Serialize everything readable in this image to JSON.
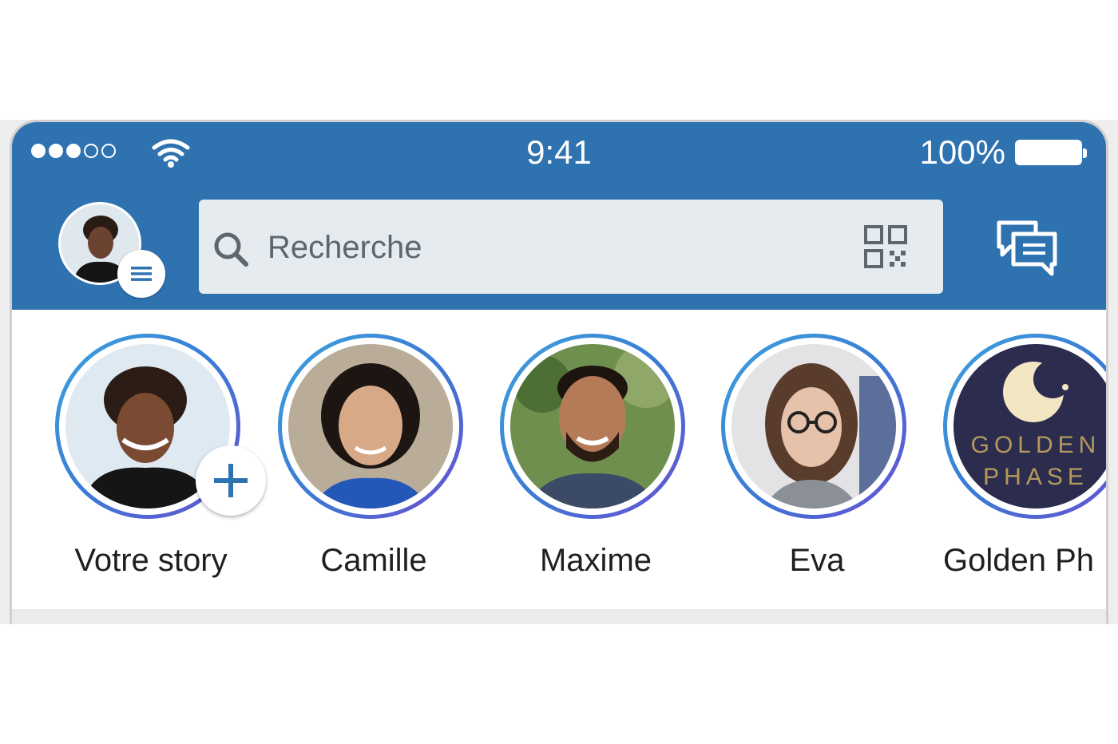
{
  "status_bar": {
    "time": "9:41",
    "battery_percent": "100%",
    "signal_dots": [
      true,
      true,
      true,
      false,
      false
    ],
    "wifi_icon": "wifi-icon"
  },
  "header": {
    "menu_icon": "menu-icon",
    "search": {
      "placeholder": "Recherche",
      "search_icon": "search-icon",
      "qr_icon": "qr-code-icon"
    },
    "messaging_icon": "messaging-icon"
  },
  "stories": [
    {
      "name": "Votre story",
      "is_own": true,
      "add_icon": "plus-icon"
    },
    {
      "name": "Camille"
    },
    {
      "name": "Maxime"
    },
    {
      "name": "Eva"
    },
    {
      "name": "Golden Ph",
      "logo_text": [
        "GOLDEN",
        "PHASE"
      ]
    }
  ],
  "colors": {
    "brand_blue": "#2f72b0",
    "search_bg": "#e6ebef",
    "ring_gradient": [
      "#3ea3dc",
      "#6a4fd0"
    ]
  }
}
